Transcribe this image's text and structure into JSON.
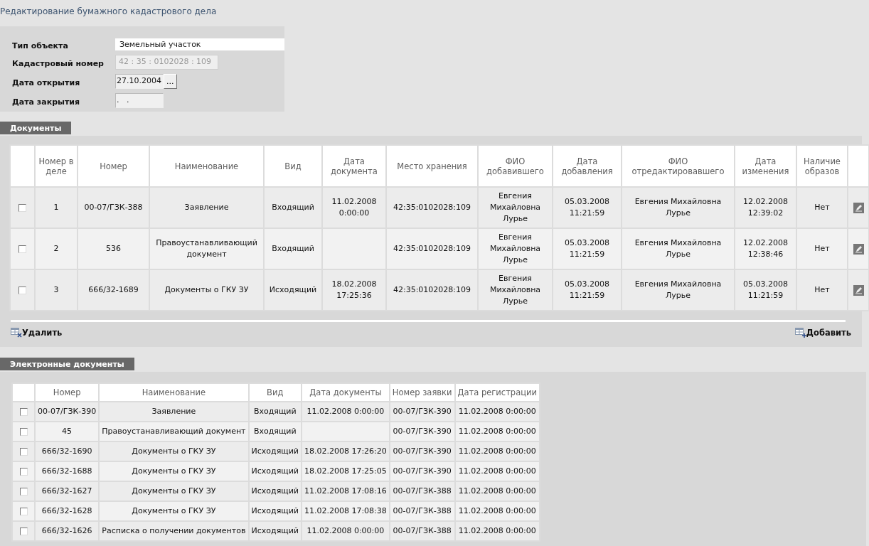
{
  "title": "Редактирование бумажного кадастрового дела",
  "form": {
    "fields": [
      {
        "label": "Тип объекта",
        "kind": "select",
        "value": "Земельный участок"
      },
      {
        "label": "Кадастровый номер",
        "kind": "readonly",
        "value": "42 : 35 : 0102028 : 109"
      },
      {
        "label": "Дата открытия",
        "kind": "date",
        "value": "27.10.2004",
        "button": "..."
      },
      {
        "label": "Дата закрытия",
        "kind": "date",
        "value": ".   ."
      }
    ]
  },
  "documents": {
    "header": "Документы",
    "columns": [
      "Номер в деле",
      "Номер",
      "Наименование",
      "Вид",
      "Дата документа",
      "Место хранения",
      "ФИО добавившего",
      "Дата добавления",
      "ФИО отредактировавшего",
      "Дата изменения",
      "Наличие образов"
    ],
    "rows": [
      {
        "checked": false,
        "cells": [
          "1",
          "00-07/ГЗК-388",
          "Заявление",
          "Входящий",
          "11.02.2008 0:00:00",
          "42:35:0102028:109",
          "Евгения Михайловна Лурье",
          "05.03.2008 11:21:59",
          "Евгения Михайловна Лурье",
          "12.02.2008 12:39:02",
          "Нет"
        ]
      },
      {
        "checked": false,
        "cells": [
          "2",
          "536",
          "Правоустанавливающий документ",
          "Входящий",
          "",
          "42:35:0102028:109",
          "Евгения Михайловна Лурье",
          "05.03.2008 11:21:59",
          "Евгения Михайловна Лурье",
          "12.02.2008 12:38:46",
          "Нет"
        ]
      },
      {
        "checked": false,
        "cells": [
          "3",
          "666/32-1689",
          "Документы о ГКУ ЗУ",
          "Исходящий",
          "18.02.2008 17:25:36",
          "42:35:0102028:109",
          "Евгения Михайловна Лурье",
          "05.03.2008 11:21:59",
          "Евгения Михайловна Лурье",
          "05.03.2008 11:21:59",
          "Нет"
        ]
      }
    ],
    "delete_label": "Удалить",
    "add_label": "Добавить"
  },
  "electronic": {
    "header": "Электронные документы",
    "columns": [
      "Номер",
      "Наименование",
      "Вид",
      "Дата документы",
      "Номер заявки",
      "Дата регистрации"
    ],
    "rows": [
      {
        "checked": false,
        "cells": [
          "00-07/ГЗК-390",
          "Заявление",
          "Входящий",
          "11.02.2008 0:00:00",
          "00-07/ГЗК-390",
          "11.02.2008 0:00:00"
        ]
      },
      {
        "checked": false,
        "cells": [
          "45",
          "Правоустанавливающий документ",
          "Входящий",
          "",
          "00-07/ГЗК-390",
          "11.02.2008 0:00:00"
        ]
      },
      {
        "checked": false,
        "cells": [
          "666/32-1690",
          "Документы о ГКУ ЗУ",
          "Исходящий",
          "18.02.2008 17:26:20",
          "00-07/ГЗК-390",
          "11.02.2008 0:00:00"
        ]
      },
      {
        "checked": false,
        "cells": [
          "666/32-1688",
          "Документы о ГКУ ЗУ",
          "Исходящий",
          "18.02.2008 17:25:05",
          "00-07/ГЗК-390",
          "11.02.2008 0:00:00"
        ]
      },
      {
        "checked": false,
        "cells": [
          "666/32-1627",
          "Документы о ГКУ ЗУ",
          "Исходящий",
          "11.02.2008 17:08:16",
          "00-07/ГЗК-388",
          "11.02.2008 0:00:00"
        ]
      },
      {
        "checked": false,
        "cells": [
          "666/32-1628",
          "Документы о ГКУ ЗУ",
          "Исходящий",
          "11.02.2008 17:08:38",
          "00-07/ГЗК-388",
          "11.02.2008 0:00:00"
        ]
      },
      {
        "checked": false,
        "cells": [
          "666/32-1626",
          "Расписка о получении документов",
          "Исходящий",
          "11.02.2008 0:00:00",
          "00-07/ГЗК-388",
          "11.02.2008 0:00:00"
        ]
      }
    ]
  }
}
